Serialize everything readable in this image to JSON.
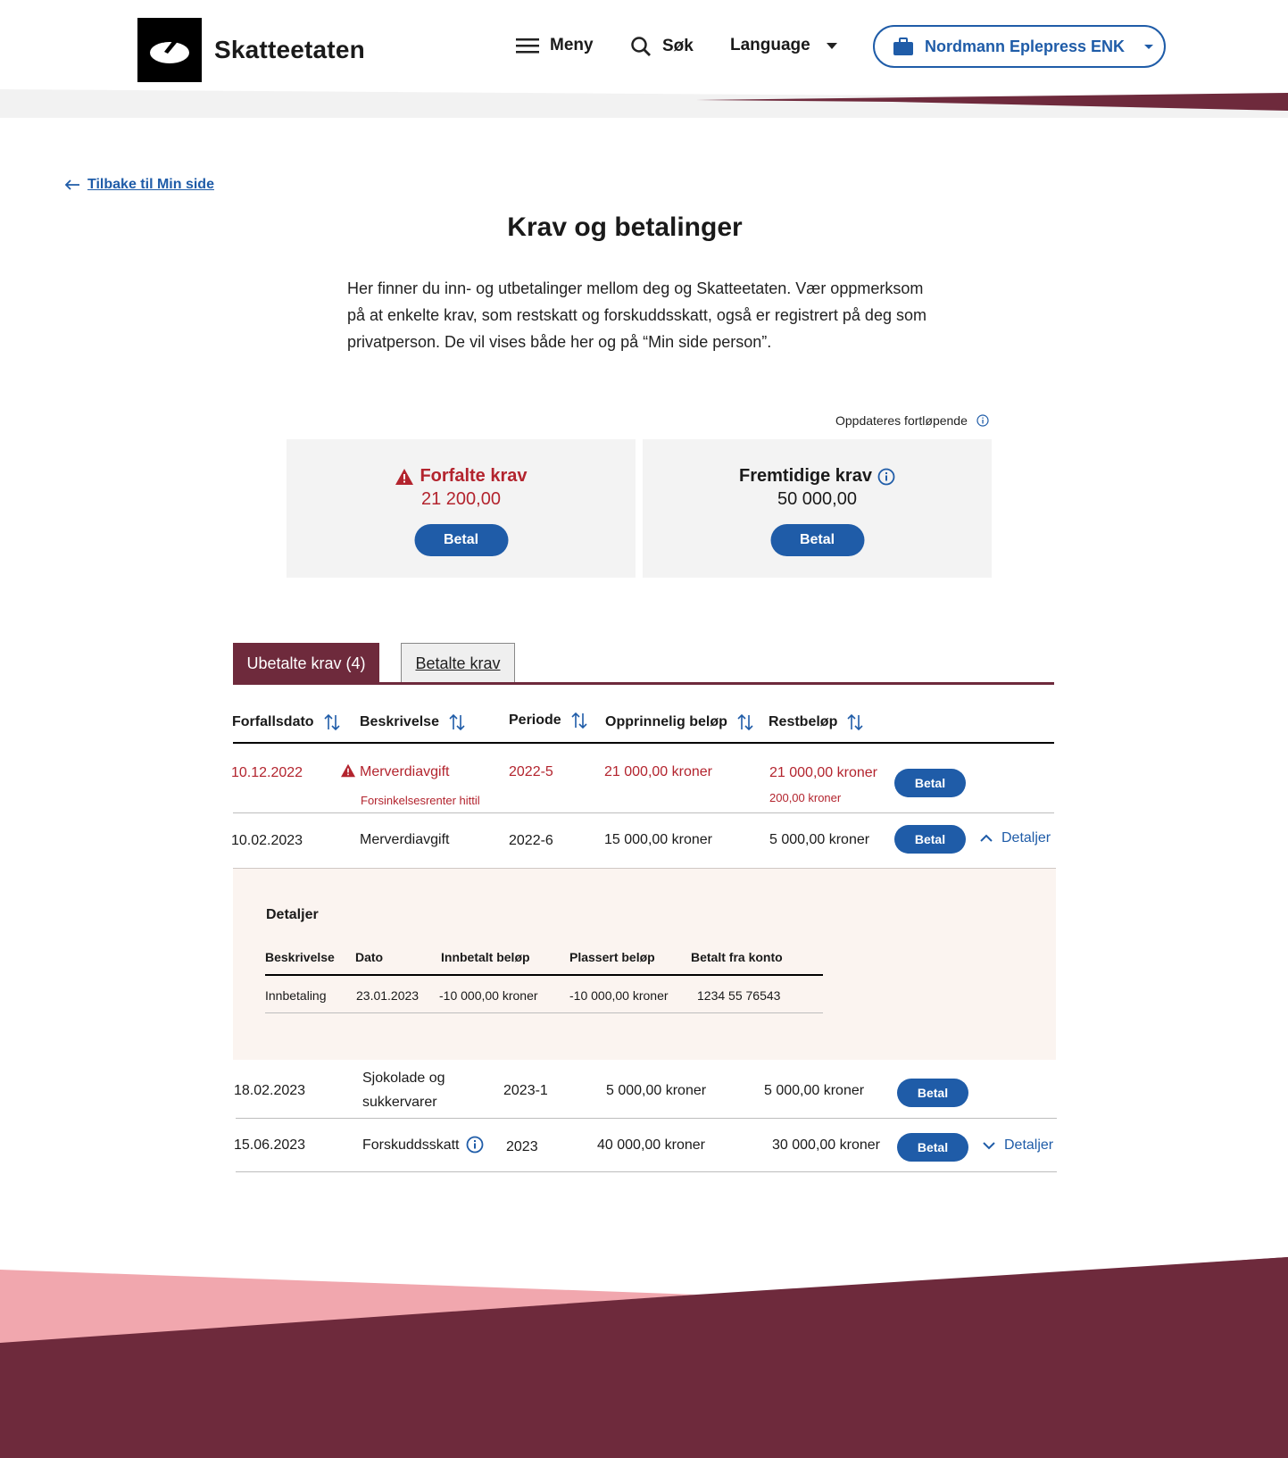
{
  "header": {
    "brand": "Skatteetaten",
    "menu_label": "Meny",
    "search_label": "Søk",
    "language_label": "Language",
    "org_label": "Nordmann Eplepress ENK"
  },
  "back_link": "Tilbake til Min side",
  "page_title": "Krav og betalinger",
  "intro": "Her finner du inn- og utbetalinger mellom deg og Skatteetaten. Vær oppmerksom på at enkelte krav, som restskatt og forskuddsskatt, også er registrert på deg som privatperson. De vil vises både her og på “Min side person”.",
  "updated_note": "Oppdateres fortløpende",
  "cards": {
    "overdue": {
      "title": "Forfalte krav",
      "amount": "21 200,00",
      "button": "Betal"
    },
    "future": {
      "title": "Fremtidige krav",
      "amount": "50 000,00",
      "button": "Betal"
    }
  },
  "tabs": {
    "unpaid": "Ubetalte krav (4)",
    "paid": "Betalte krav"
  },
  "table": {
    "headers": {
      "due_date": "Forfallsdato",
      "description": "Beskrivelse",
      "period": "Periode",
      "original": "Opprinnelig beløp",
      "remaining": "Restbeløp"
    },
    "rows": [
      {
        "due_date": "10.12.2022",
        "description": "Merverdiavgift",
        "sub_description": "Forsinkelsesrenter hittil",
        "period": "2022-5",
        "original": "21 000,00 kroner",
        "remaining": "21 000,00 kroner",
        "sub_remaining": "200,00 kroner",
        "button": "Betal"
      },
      {
        "due_date": "10.02.2023",
        "description": "Merverdiavgift",
        "period": "2022-6",
        "original": "15 000,00 kroner",
        "remaining": "5 000,00 kroner",
        "button": "Betal",
        "details_label": "Detaljer"
      },
      {
        "due_date": "18.02.2023",
        "description_line1": "Sjokolade og",
        "description_line2": "sukkervarer",
        "period": "2023-1",
        "original": "5 000,00 kroner",
        "remaining": "5 000,00 kroner",
        "button": "Betal"
      },
      {
        "due_date": "15.06.2023",
        "description": "Forskuddsskatt",
        "period": "2023",
        "original": "40 000,00 kroner",
        "remaining": "30 000,00 kroner",
        "button": "Betal",
        "details_label": "Detaljer"
      }
    ]
  },
  "details": {
    "title": "Detaljer",
    "headers": {
      "description": "Beskrivelse",
      "date": "Dato",
      "paid_in": "Innbetalt beløp",
      "placed": "Plassert beløp",
      "account": "Betalt fra konto"
    },
    "row": {
      "description": "Innbetaling",
      "date": "23.01.2023",
      "paid_in": "-10 000,00 kroner",
      "placed": "-10 000,00 kroner",
      "account": "1234 55 76543"
    }
  },
  "colors": {
    "primary_blue": "#1f5ca8",
    "burgundy": "#6e2a3c",
    "alert_red": "#b3242e",
    "pink": "#f1a7ae"
  }
}
